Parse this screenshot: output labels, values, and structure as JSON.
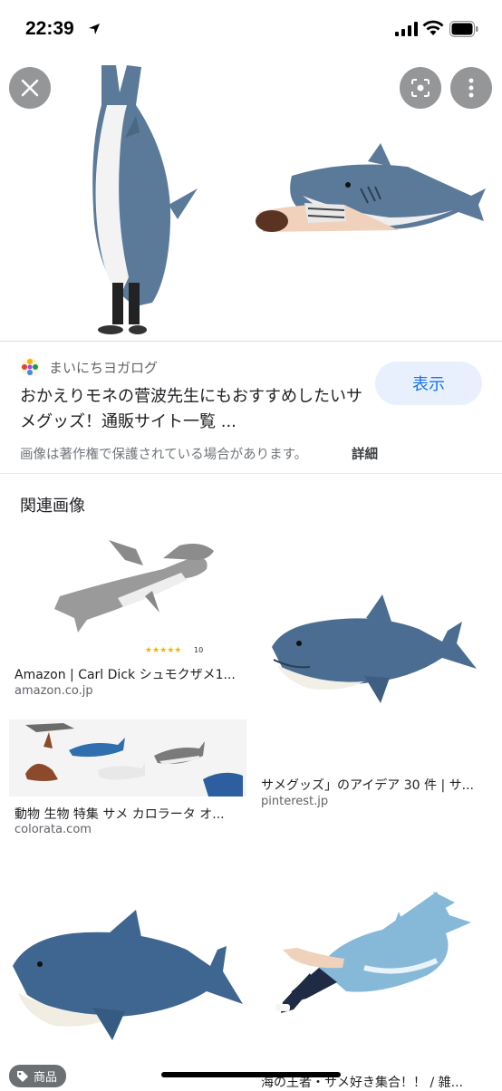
{
  "status_bar": {
    "time": "22:39"
  },
  "hero": {
    "source_name": "まいにちヨガログ"
  },
  "result": {
    "title": "おかえりモネの菅波先生にもおすすめしたいサメグッズ！通販サイト一覧 ...",
    "visit_label": "表示",
    "copyright_notice": "画像は著作権で保護されている場合があります。",
    "details_label": "詳細"
  },
  "related": {
    "heading": "関連画像",
    "items": [
      {
        "title": "Amazon | Carl Dick シュモクザメ1...",
        "domain": "amazon.co.jp",
        "rating": "10"
      },
      {
        "title": "サメグッズ」のアイデア 30 件 | サ...",
        "domain": "pinterest.jp"
      },
      {
        "title": "動物 生物 特集 サメ カロラータ オ...",
        "domain": "colorata.com"
      },
      {
        "title": "",
        "domain": ""
      },
      {
        "title": "海の王者・サメ好き集合！！ / 雑...",
        "domain": ""
      }
    ],
    "product_badge": "商品"
  },
  "colors": {
    "accent": "#1a73e8",
    "visit_bg": "#e8f0fe",
    "shark_blue": "#4f6f8f",
    "shark_belly": "#f1efe8"
  }
}
